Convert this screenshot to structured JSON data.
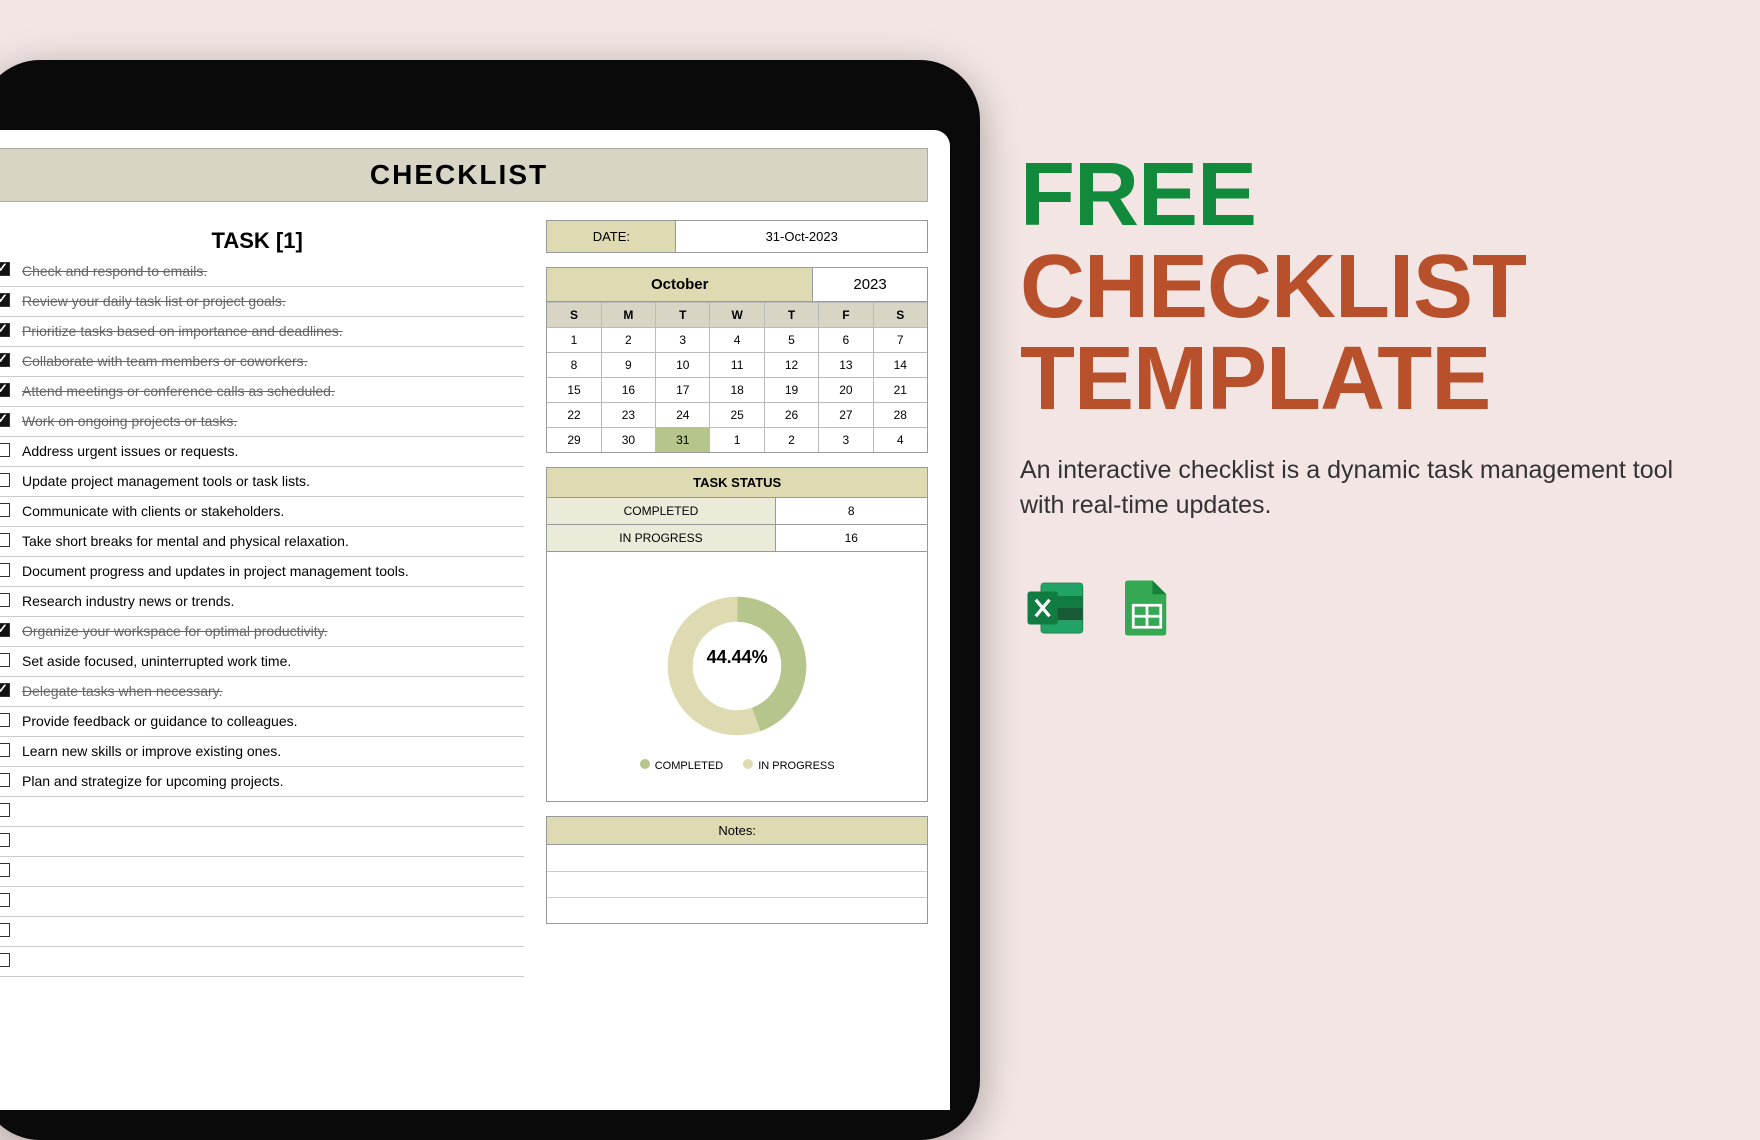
{
  "header": "CHECKLIST",
  "task_title": "TASK [1]",
  "tasks": [
    {
      "done": true,
      "text": "Check and respond to emails."
    },
    {
      "done": true,
      "text": "Review your daily task list or project goals."
    },
    {
      "done": true,
      "text": "Prioritize tasks based on importance and deadlines."
    },
    {
      "done": true,
      "text": "Collaborate with team members or coworkers."
    },
    {
      "done": true,
      "text": "Attend meetings or conference calls as scheduled."
    },
    {
      "done": true,
      "text": "Work on ongoing projects or tasks."
    },
    {
      "done": false,
      "text": "Address urgent issues or requests."
    },
    {
      "done": false,
      "text": "Update project management tools or task lists."
    },
    {
      "done": false,
      "text": "Communicate with clients or stakeholders."
    },
    {
      "done": false,
      "text": "Take short breaks for mental and physical relaxation."
    },
    {
      "done": false,
      "text": "Document progress and updates in project management tools."
    },
    {
      "done": false,
      "text": "Research industry news or trends."
    },
    {
      "done": true,
      "text": "Organize your workspace for optimal productivity."
    },
    {
      "done": false,
      "text": "Set aside focused, uninterrupted work time."
    },
    {
      "done": true,
      "text": "Delegate tasks when necessary."
    },
    {
      "done": false,
      "text": "Provide feedback or guidance to colleagues."
    },
    {
      "done": false,
      "text": "Learn new skills or improve existing ones."
    },
    {
      "done": false,
      "text": "Plan and strategize for upcoming projects."
    },
    {
      "done": false,
      "text": ""
    },
    {
      "done": false,
      "text": ""
    },
    {
      "done": false,
      "text": ""
    },
    {
      "done": false,
      "text": ""
    },
    {
      "done": false,
      "text": ""
    },
    {
      "done": false,
      "text": ""
    }
  ],
  "date_label": "DATE:",
  "date_value": "31-Oct-2023",
  "calendar": {
    "month": "October",
    "year": "2023",
    "days": [
      "S",
      "M",
      "T",
      "W",
      "T",
      "F",
      "S"
    ],
    "weeks": [
      [
        "1",
        "2",
        "3",
        "4",
        "5",
        "6",
        "7"
      ],
      [
        "8",
        "9",
        "10",
        "11",
        "12",
        "13",
        "14"
      ],
      [
        "15",
        "16",
        "17",
        "18",
        "19",
        "20",
        "21"
      ],
      [
        "22",
        "23",
        "24",
        "25",
        "26",
        "27",
        "28"
      ],
      [
        "29",
        "30",
        "31",
        "1",
        "2",
        "3",
        "4"
      ]
    ],
    "today": "31"
  },
  "status": {
    "title": "TASK STATUS",
    "rows": [
      {
        "label": "COMPLETED",
        "value": "8"
      },
      {
        "label": "IN PROGRESS",
        "value": "16"
      }
    ],
    "legend_completed": "COMPLETED",
    "legend_inprogress": "IN PROGRESS"
  },
  "chart_data": {
    "type": "pie",
    "title": "TASK STATUS",
    "series": [
      {
        "name": "COMPLETED",
        "value": 8,
        "color": "#b5c58b"
      },
      {
        "name": "IN PROGRESS",
        "value": 16,
        "color": "#dedab1"
      }
    ],
    "center_label": "44.44%"
  },
  "notes_label": "Notes:",
  "promo": {
    "line1": "FREE",
    "line2": "CHECKLIST",
    "line3": "TEMPLATE",
    "desc": "An interactive checklist is a dynamic task management tool with real-time updates."
  }
}
